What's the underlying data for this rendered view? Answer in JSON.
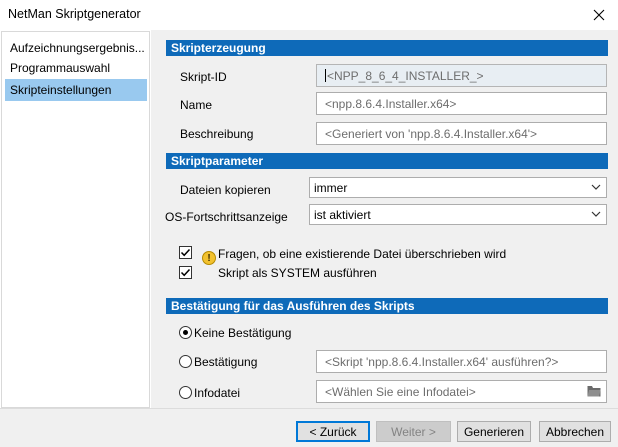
{
  "window": {
    "title": "NetMan Skriptgenerator"
  },
  "sidebar": {
    "items": [
      {
        "label": "Aufzeichnungsergebnis..."
      },
      {
        "label": "Programmauswahl"
      },
      {
        "label": "Skripteinstellungen",
        "active": true
      }
    ]
  },
  "sections": {
    "erzeugung": "Skripterzeugung",
    "parameter": "Skriptparameter",
    "bestaetigung": "Bestätigung für das Ausführen des Skripts"
  },
  "erzeugung": {
    "skript_id_label": "Skript-ID",
    "skript_id_value": "<NPP_8_6_4_INSTALLER_>",
    "name_label": "Name",
    "name_placeholder": "<npp.8.6.4.Installer.x64>",
    "beschreibung_label": "Beschreibung",
    "beschreibung_placeholder": "<Generiert von 'npp.8.6.4.Installer.x64'>"
  },
  "parameter": {
    "dateien_label": "Dateien kopieren",
    "dateien_value": "immer",
    "os_label": "OS-Fortschrittsanzeige",
    "os_value": "ist aktiviert",
    "check1_label": "Fragen, ob eine existierende Datei überschrieben wird",
    "check1_checked": true,
    "check2_label": "Skript als SYSTEM ausführen",
    "check2_checked": true
  },
  "bestaetigung": {
    "opt1_label": "Keine Bestätigung",
    "opt2_label": "Bestätigung",
    "opt2_placeholder": "<Skript 'npp.8.6.4.Installer.x64' ausführen?>",
    "opt3_label": "Infodatei",
    "opt3_placeholder": "<Wählen Sie eine Infodatei>",
    "selected": "Keine Bestätigung"
  },
  "buttons": {
    "back": "< Zurück",
    "next": "Weiter >",
    "generate": "Generieren",
    "cancel": "Abbrechen"
  },
  "colors": {
    "section_header": "#0e6ab9",
    "sidebar_active": "#99c9ef",
    "warning_icon": "#f2c12e"
  }
}
